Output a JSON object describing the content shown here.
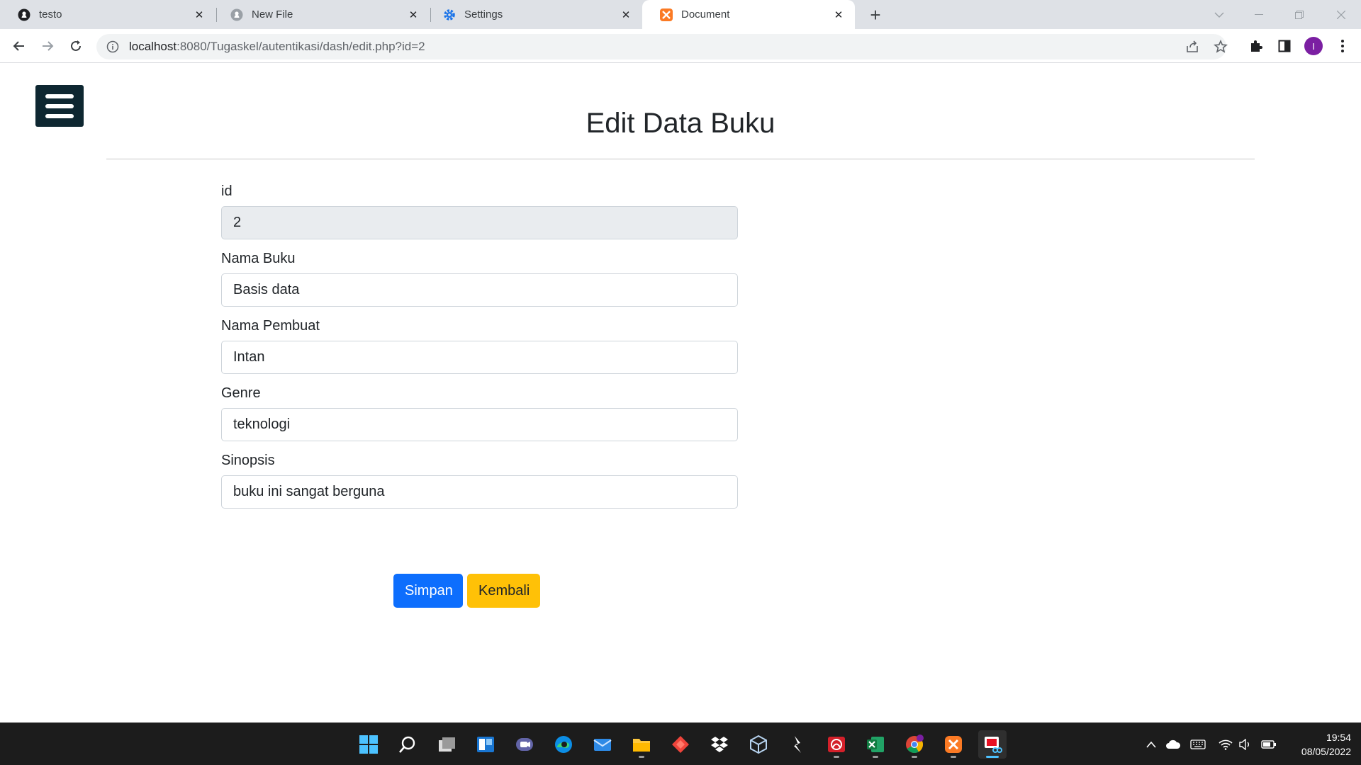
{
  "browser": {
    "tabs": [
      {
        "title": "testo",
        "icon": "github-icon",
        "active": false
      },
      {
        "title": "New File",
        "icon": "github-icon",
        "active": false
      },
      {
        "title": "Settings",
        "icon": "gear-icon",
        "active": false
      },
      {
        "title": "Document",
        "icon": "xampp-icon",
        "active": true
      }
    ],
    "url_host": "localhost",
    "url_rest": ":8080/Tugaskel/autentikasi/dash/edit.php?id=2",
    "profile_initial": "I"
  },
  "page": {
    "title": "Edit Data Buku",
    "fields": [
      {
        "label": "id",
        "value": "2",
        "readonly": true
      },
      {
        "label": "Nama Buku",
        "value": "Basis data",
        "readonly": false
      },
      {
        "label": "Nama Pembuat",
        "value": "Intan",
        "readonly": false
      },
      {
        "label": "Genre",
        "value": "teknologi",
        "readonly": false
      },
      {
        "label": "Sinopsis",
        "value": "buku ini sangat berguna",
        "readonly": false
      }
    ],
    "save_label": "Simpan",
    "back_label": "Kembali",
    "colors": {
      "primary": "#0d6efd",
      "warning": "#ffc107",
      "menu": "#0e2731"
    }
  },
  "taskbar": {
    "apps": [
      "windows-start-icon",
      "search-icon",
      "task-view-icon",
      "widgets-icon",
      "teams-chat-icon",
      "edge-icon",
      "mail-icon",
      "file-explorer-icon",
      "anydesk-icon",
      "dropbox-icon",
      "virtualbox-icon",
      "git-icon",
      "acrobat-icon",
      "excel-icon",
      "chrome-icon",
      "xampp-icon",
      "snipping-tool-icon"
    ],
    "time": "19:54",
    "date": "08/05/2022"
  }
}
